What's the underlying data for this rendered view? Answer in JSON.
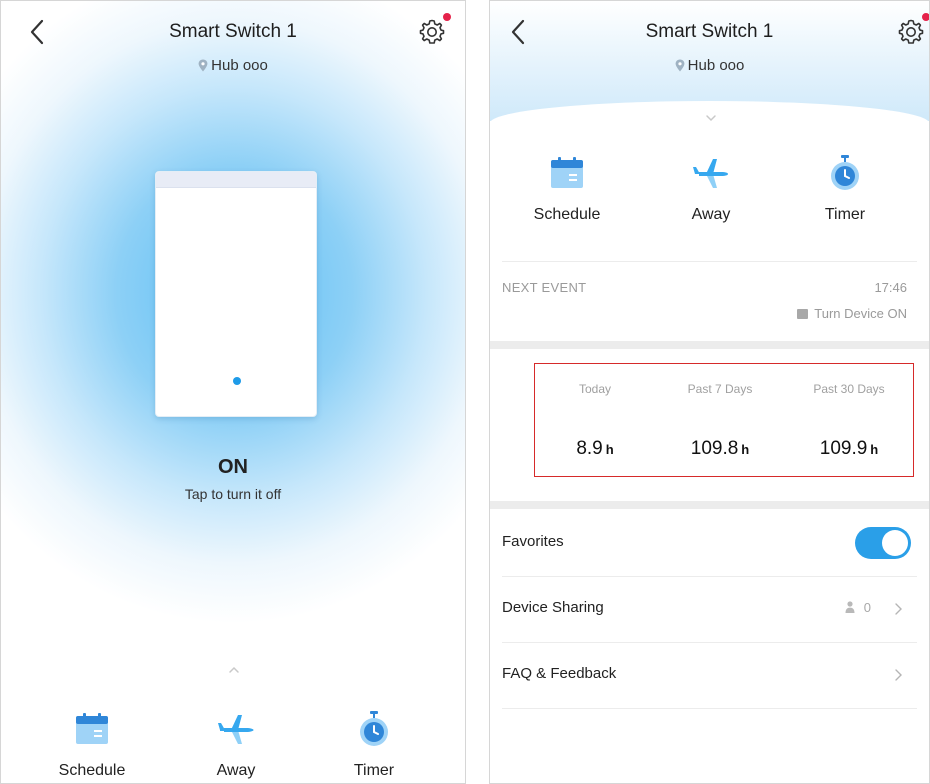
{
  "colors": {
    "accent": "#2a9fe8",
    "notification_dot": "#e5224a",
    "highlight_border": "#d62a2a",
    "glow": "#5bbef4"
  },
  "left_screen": {
    "header": {
      "title": "Smart Switch 1",
      "location": "Hub ooo",
      "back_icon": "chevron-left-icon",
      "settings_icon": "gear-icon"
    },
    "device": {
      "state": "ON",
      "hint": "Tap to turn it off"
    },
    "quick_actions": [
      {
        "label": "Schedule",
        "icon": "calendar-icon"
      },
      {
        "label": "Away",
        "icon": "airplane-icon"
      },
      {
        "label": "Timer",
        "icon": "stopwatch-icon"
      }
    ]
  },
  "right_screen": {
    "header": {
      "title": "Smart Switch 1",
      "location": "Hub ooo",
      "back_icon": "chevron-left-icon",
      "settings_icon": "gear-icon"
    },
    "quick_actions": [
      {
        "label": "Schedule",
        "icon": "calendar-icon"
      },
      {
        "label": "Away",
        "icon": "airplane-icon"
      },
      {
        "label": "Timer",
        "icon": "stopwatch-icon"
      }
    ],
    "next_event": {
      "label": "NEXT EVENT",
      "time": "17:46",
      "action": "Turn Device ON"
    },
    "usage": [
      {
        "period": "Today",
        "value": "8.9",
        "unit": "h"
      },
      {
        "period": "Past 7 Days",
        "value": "109.8",
        "unit": "h"
      },
      {
        "period": "Past 30 Days",
        "value": "109.9",
        "unit": "h"
      }
    ],
    "settings_rows": {
      "favorites": {
        "label": "Favorites",
        "enabled": true
      },
      "device_sharing": {
        "label": "Device Sharing",
        "count": "0"
      },
      "faq": {
        "label": "FAQ & Feedback"
      }
    }
  }
}
